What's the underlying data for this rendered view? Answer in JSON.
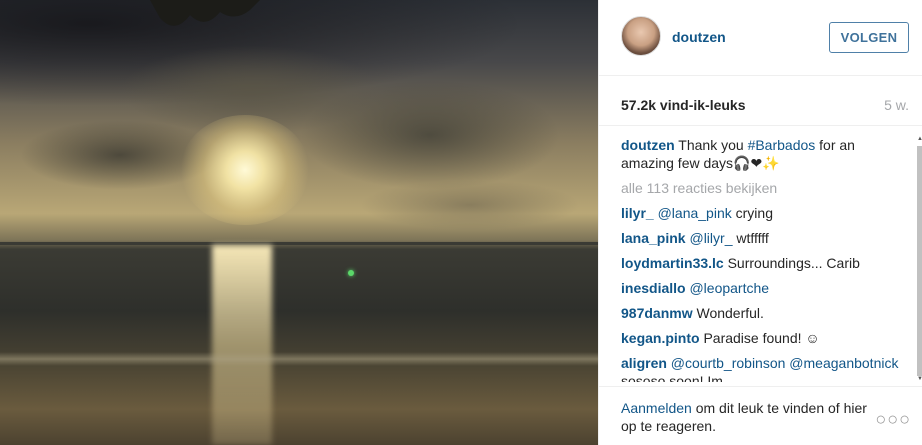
{
  "post": {
    "username": "doutzen",
    "follow_label": "VOLGEN",
    "likes": "57.2k vind-ik-leuks",
    "age": "5 w.",
    "caption": {
      "user": "doutzen",
      "text_before": "Thank you ",
      "tag": "#Barbados",
      "text_after": " for an amazing few days🎧❤✨"
    },
    "view_all": "alle 113 reacties bekijken",
    "comments": [
      {
        "user": "lilyr_",
        "mention": "@lana_pink",
        "text": " crying"
      },
      {
        "user": "lana_pink",
        "mention": "@lilyr_",
        "text": " wtfffff"
      },
      {
        "user": "loydmartin33.lc",
        "mention": "",
        "text": "Surroundings... Carib"
      },
      {
        "user": "inesdiallo",
        "mention": "@leopartche",
        "text": ""
      },
      {
        "user": "987danmw",
        "mention": "",
        "text": "Wonderful."
      },
      {
        "user": "kegan.pinto",
        "mention": "",
        "text": "Paradise found! ☺"
      },
      {
        "user": "aligren",
        "mention": "@courtb_robinson @meaganbotnick",
        "text": " sososo soon! Im"
      }
    ],
    "footer": {
      "login_link": "Aanmelden",
      "rest": " om dit leuk te vinden of hier op te reageren."
    },
    "more_label": "○○○"
  }
}
